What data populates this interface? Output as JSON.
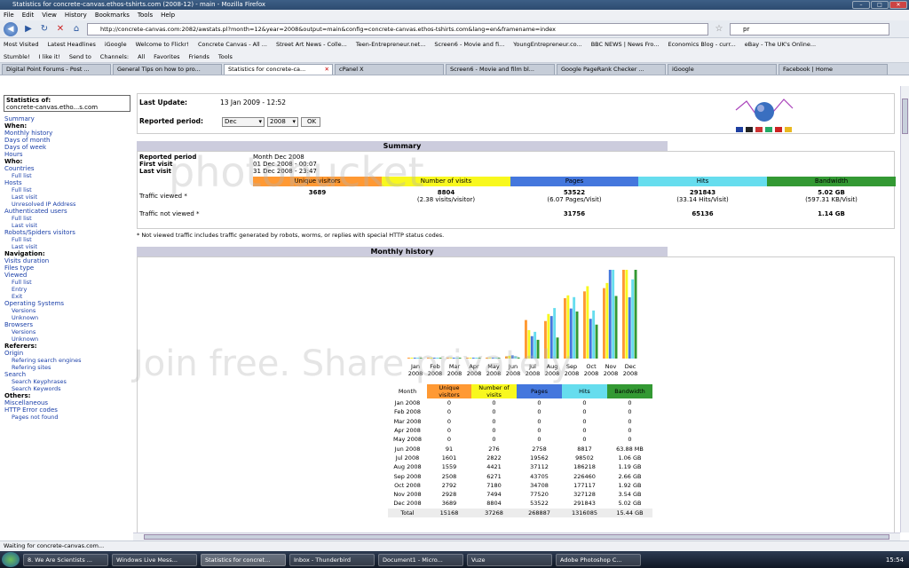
{
  "window": {
    "title": "Statistics for concrete-canvas.ethos-tshirts.com (2008-12) - main - Mozilla Firefox"
  },
  "menu": [
    "File",
    "Edit",
    "View",
    "History",
    "Bookmarks",
    "Tools",
    "Help"
  ],
  "nav": {
    "url": "http://concrete-canvas.com:2082/awstats.pl?month=12&year=2008&output=main&config=concrete-canvas.ethos-tshirts.com&lang=en&framename=index",
    "search_value": "pr"
  },
  "bookmarks": [
    "Most Visited",
    "Latest Headlines",
    "iGoogle",
    "Welcome to Flickr!",
    "Concrete Canvas - All ...",
    "Street Art News - Colle...",
    "Teen-Entrepreneur.net...",
    "Screen6 - Movie and fi...",
    "YoungEntrepreneur.co...",
    "BBC NEWS | News Fro...",
    "Economics Blog - curr...",
    "eBay - The UK's Online..."
  ],
  "toolbar2": [
    "Stumble!",
    "I like it!",
    "Send to",
    "Channels:",
    "All",
    "Favorites",
    "Friends",
    "Tools"
  ],
  "tabs": [
    {
      "label": "Digital Point Forums - Post ..."
    },
    {
      "label": "General Tips on how to pro..."
    },
    {
      "label": "Statistics for concrete-ca..."
    },
    {
      "label": "cPanel X"
    },
    {
      "label": "Screen6 - Movie and film bl..."
    },
    {
      "label": "Google PageRank Checker ..."
    },
    {
      "label": "iGoogle"
    },
    {
      "label": "Facebook | Home"
    }
  ],
  "sidebar": {
    "stats_of": "Statistics of:",
    "domain": "concrete-canvas.etho...s.com",
    "items": [
      {
        "t": "link",
        "v": "Summary"
      },
      {
        "t": "head",
        "v": "When:"
      },
      {
        "t": "link",
        "v": "Monthly history"
      },
      {
        "t": "link",
        "v": "Days of month"
      },
      {
        "t": "link",
        "v": "Days of week"
      },
      {
        "t": "link",
        "v": "Hours"
      },
      {
        "t": "head",
        "v": "Who:"
      },
      {
        "t": "link",
        "v": "Countries"
      },
      {
        "t": "sub",
        "v": "Full list"
      },
      {
        "t": "link",
        "v": "Hosts"
      },
      {
        "t": "sub",
        "v": "Full list"
      },
      {
        "t": "sub",
        "v": "Last visit"
      },
      {
        "t": "sub",
        "v": "Unresolved IP Address"
      },
      {
        "t": "link",
        "v": "Authenticated users"
      },
      {
        "t": "sub",
        "v": "Full list"
      },
      {
        "t": "sub",
        "v": "Last visit"
      },
      {
        "t": "link",
        "v": "Robots/Spiders visitors"
      },
      {
        "t": "sub",
        "v": "Full list"
      },
      {
        "t": "sub",
        "v": "Last visit"
      },
      {
        "t": "head",
        "v": "Navigation:"
      },
      {
        "t": "link",
        "v": "Visits duration"
      },
      {
        "t": "link",
        "v": "Files type"
      },
      {
        "t": "link",
        "v": "Viewed"
      },
      {
        "t": "sub",
        "v": "Full list"
      },
      {
        "t": "sub",
        "v": "Entry"
      },
      {
        "t": "sub",
        "v": "Exit"
      },
      {
        "t": "link",
        "v": "Operating Systems"
      },
      {
        "t": "sub",
        "v": "Versions"
      },
      {
        "t": "sub",
        "v": "Unknown"
      },
      {
        "t": "link",
        "v": "Browsers"
      },
      {
        "t": "sub",
        "v": "Versions"
      },
      {
        "t": "sub",
        "v": "Unknown"
      },
      {
        "t": "head",
        "v": "Referers:"
      },
      {
        "t": "link",
        "v": "Origin"
      },
      {
        "t": "sub",
        "v": "Refering search engines"
      },
      {
        "t": "sub",
        "v": "Refering sites"
      },
      {
        "t": "link",
        "v": "Search"
      },
      {
        "t": "sub",
        "v": "Search Keyphrases"
      },
      {
        "t": "sub",
        "v": "Search Keywords"
      },
      {
        "t": "head",
        "v": "Others:"
      },
      {
        "t": "link",
        "v": "Miscellaneous"
      },
      {
        "t": "link",
        "v": "HTTP Error codes"
      },
      {
        "t": "sub",
        "v": "Pages not found"
      }
    ]
  },
  "top": {
    "last_update_label": "Last Update:",
    "last_update": "13 Jan 2009 - 12:52",
    "period_label": "Reported period:",
    "month": "Dec",
    "year": "2008",
    "ok": "OK"
  },
  "summary": {
    "title": "Summary",
    "rp_label": "Reported period",
    "rp": "Month Dec 2008",
    "fv_label": "First visit",
    "fv": "01 Dec 2008 - 00:07",
    "lv_label": "Last visit",
    "lv": "31 Dec 2008 - 23:47",
    "cols": [
      "Unique visitors",
      "Number of visits",
      "Pages",
      "Hits",
      "Bandwidth"
    ],
    "tv_label": "Traffic viewed *",
    "tnv_label": "Traffic not viewed *",
    "tv": [
      "3689",
      "8804",
      "53522",
      "291843",
      "5.02 GB"
    ],
    "tv_sub": [
      "",
      "(2.38 visits/visitor)",
      "(6.07 Pages/Visit)",
      "(33.14 Hits/Visit)",
      "(597.31 KB/Visit)"
    ],
    "tnv": [
      "",
      "",
      "31756",
      "65136",
      "1.14 GB"
    ],
    "note": "* Not viewed traffic includes traffic generated by robots, worms, or replies with special HTTP status codes."
  },
  "colors": {
    "visitors": "#ff9933",
    "visits": "#f8f81e",
    "pages": "#4477dd",
    "hits": "#66ddee",
    "bandwidth": "#339933",
    "section": "#ccccdd"
  },
  "history": {
    "title": "Monthly history",
    "header": [
      "Month",
      "Unique visitors",
      "Number of visits",
      "Pages",
      "Hits",
      "Bandwidth"
    ],
    "rows": [
      [
        "Jan 2008",
        "0",
        "0",
        "0",
        "0",
        "0"
      ],
      [
        "Feb 2008",
        "0",
        "0",
        "0",
        "0",
        "0"
      ],
      [
        "Mar 2008",
        "0",
        "0",
        "0",
        "0",
        "0"
      ],
      [
        "Apr 2008",
        "0",
        "0",
        "0",
        "0",
        "0"
      ],
      [
        "May 2008",
        "0",
        "0",
        "0",
        "0",
        "0"
      ],
      [
        "Jun 2008",
        "91",
        "276",
        "2758",
        "8817",
        "63.88 MB"
      ],
      [
        "Jul 2008",
        "1601",
        "2822",
        "19562",
        "98502",
        "1.06 GB"
      ],
      [
        "Aug 2008",
        "1559",
        "4421",
        "37112",
        "186218",
        "1.19 GB"
      ],
      [
        "Sep 2008",
        "2508",
        "6271",
        "43705",
        "226460",
        "2.66 GB"
      ],
      [
        "Oct 2008",
        "2792",
        "7180",
        "34708",
        "177117",
        "1.92 GB"
      ],
      [
        "Nov 2008",
        "2928",
        "7494",
        "77520",
        "327128",
        "3.54 GB"
      ],
      [
        "Dec 2008",
        "3689",
        "8804",
        "53522",
        "291843",
        "5.02 GB"
      ],
      [
        "Total",
        "15168",
        "37268",
        "268887",
        "1316085",
        "15.44 GB"
      ]
    ]
  },
  "chart_data": {
    "type": "bar",
    "categories": [
      "Jan 2008",
      "Feb 2008",
      "Mar 2008",
      "Apr 2008",
      "May 2008",
      "Jun 2008",
      "Jul 2008",
      "Aug 2008",
      "Sep 2008",
      "Oct 2008",
      "Nov 2008",
      "Dec 2008"
    ],
    "axis_labels": [
      [
        "Jan",
        "2008"
      ],
      [
        "Feb",
        "2008"
      ],
      [
        "Mar",
        "2008"
      ],
      [
        "Apr",
        "2008"
      ],
      [
        "May",
        "2008"
      ],
      [
        "Jun",
        "2008"
      ],
      [
        "Jul",
        "2008"
      ],
      [
        "Aug",
        "2008"
      ],
      [
        "Sep",
        "2008"
      ],
      [
        "Oct",
        "2008"
      ],
      [
        "Nov",
        "2008"
      ],
      [
        "Dec",
        "2008"
      ]
    ],
    "series": [
      {
        "name": "Unique visitors",
        "values": [
          0,
          0,
          0,
          0,
          0,
          91,
          1601,
          1559,
          2508,
          2792,
          2928,
          3689
        ]
      },
      {
        "name": "Number of visits",
        "values": [
          0,
          0,
          0,
          0,
          0,
          276,
          2822,
          4421,
          6271,
          7180,
          7494,
          8804
        ]
      },
      {
        "name": "Pages",
        "values": [
          0,
          0,
          0,
          0,
          0,
          2758,
          19562,
          37112,
          43705,
          34708,
          77520,
          53522
        ]
      },
      {
        "name": "Hits",
        "values": [
          0,
          0,
          0,
          0,
          0,
          8817,
          98502,
          186218,
          226460,
          177117,
          327128,
          291843
        ]
      },
      {
        "name": "Bandwidth (GB)",
        "values": [
          0,
          0,
          0,
          0,
          0,
          0.06,
          1.06,
          1.19,
          2.66,
          1.92,
          3.54,
          5.02
        ]
      }
    ]
  },
  "status": "Waiting for concrete-canvas.com...",
  "taskbar": [
    "8. We Are Scientists ...",
    "Windows Live Mess...",
    "Statistics for concret...",
    "Inbox - Thunderbird",
    "Document1 - Micro...",
    "Vuze",
    "Adobe Photoshop C..."
  ],
  "clock": "15:54",
  "watermark": {
    "top": "photobucket",
    "bottom": "Join free. Share privately."
  }
}
